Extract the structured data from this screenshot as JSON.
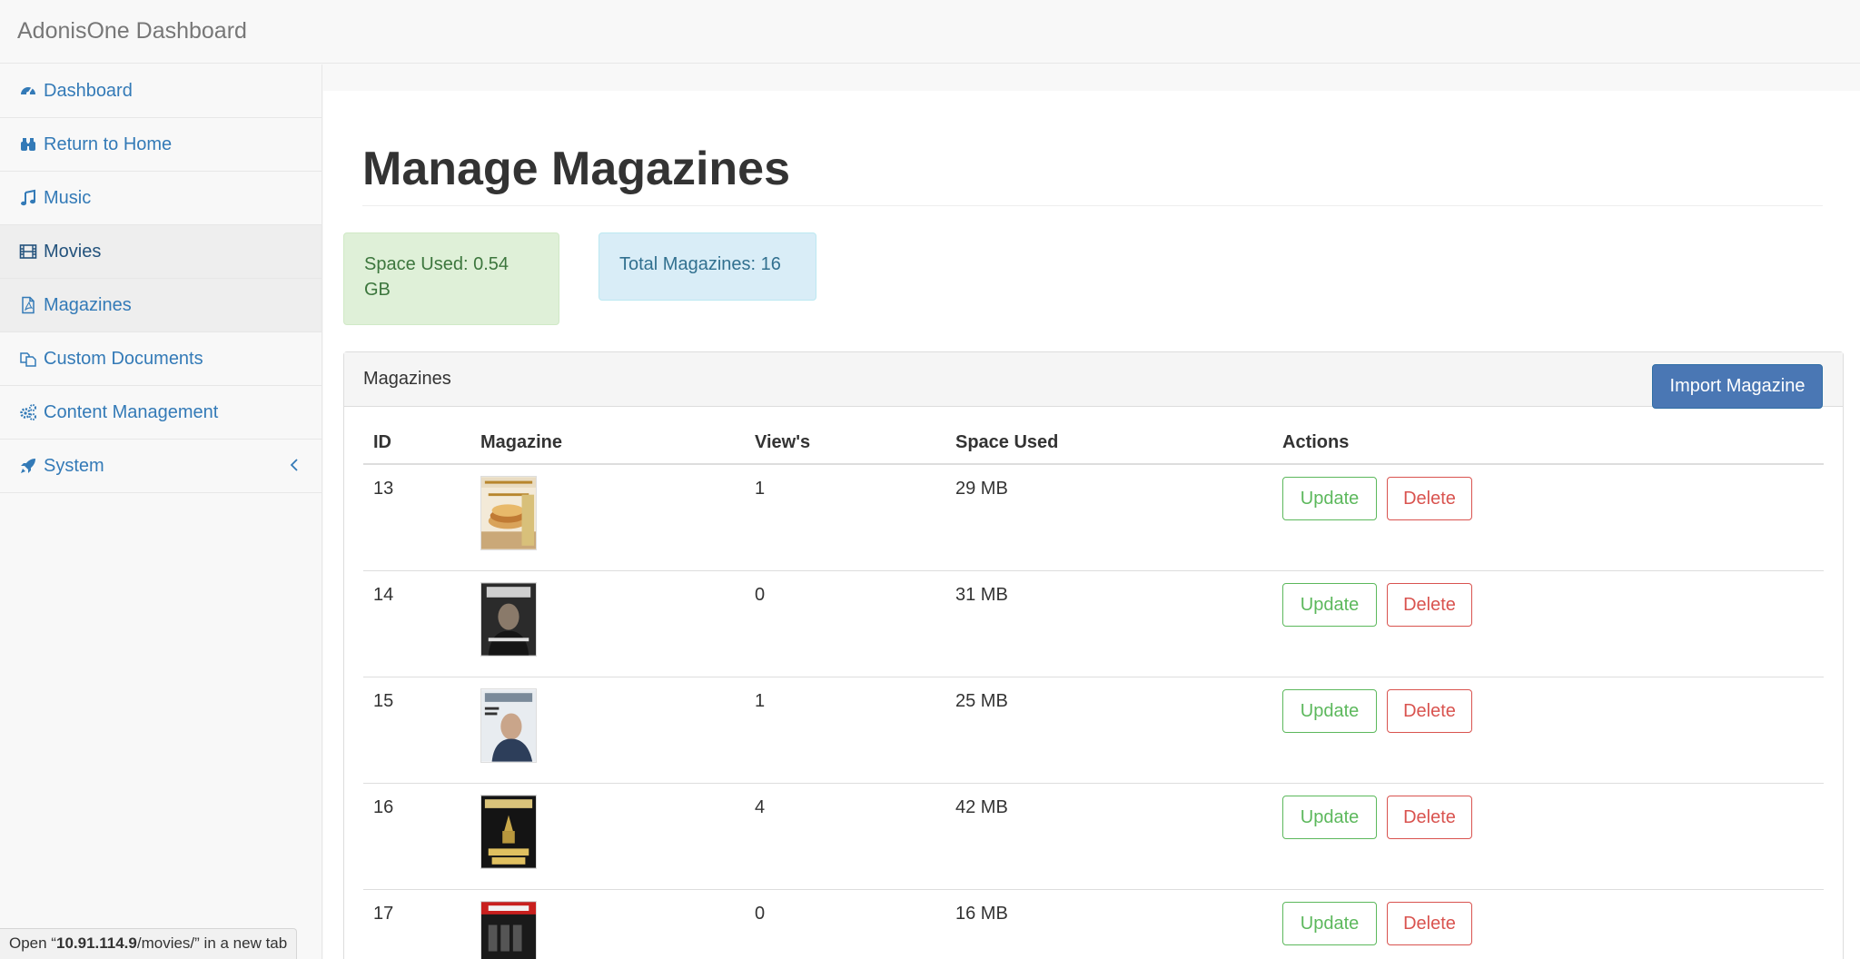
{
  "navbar": {
    "brand": "AdonisOne Dashboard"
  },
  "sidebar": {
    "items": [
      {
        "label": "Dashboard",
        "icon": "dashboard-icon"
      },
      {
        "label": "Return to Home",
        "icon": "binoculars-icon"
      },
      {
        "label": "Music",
        "icon": "music-note-icon"
      },
      {
        "label": "Movies",
        "icon": "film-icon"
      },
      {
        "label": "Magazines",
        "icon": "pdf-file-icon"
      },
      {
        "label": "Custom Documents",
        "icon": "copy-files-icon"
      },
      {
        "label": "Content Management",
        "icon": "gears-icon"
      },
      {
        "label": "System",
        "icon": "rocket-icon"
      }
    ]
  },
  "page": {
    "title": "Manage Magazines"
  },
  "stats": {
    "space_used": "Space Used: 0.54 GB",
    "total": "Total Magazines: 16"
  },
  "panel": {
    "title": "Magazines",
    "import_label": "Import Magazine"
  },
  "table": {
    "headers": [
      "ID",
      "Magazine",
      "View's",
      "Space Used",
      "Actions"
    ],
    "rows": [
      {
        "id": "13",
        "views": "1",
        "space": "29 MB",
        "cover": "cooking-light-cover"
      },
      {
        "id": "14",
        "views": "0",
        "space": "31 MB",
        "cover": "forbes-cover"
      },
      {
        "id": "15",
        "views": "1",
        "space": "25 MB",
        "cover": "fortune-cover"
      },
      {
        "id": "16",
        "views": "4",
        "space": "42 MB",
        "cover": "motor-trend-cover"
      },
      {
        "id": "17",
        "views": "0",
        "space": "16 MB",
        "cover": "newsweek-cover"
      }
    ],
    "update_label": "Update",
    "delete_label": "Delete"
  },
  "status_bar": {
    "prefix": "Open “",
    "host": "10.91.114.9",
    "suffix": "/movies/” in a new tab"
  },
  "colors": {
    "primary": "#337ab7",
    "success": "#5cb85c",
    "danger": "#d9534f"
  }
}
